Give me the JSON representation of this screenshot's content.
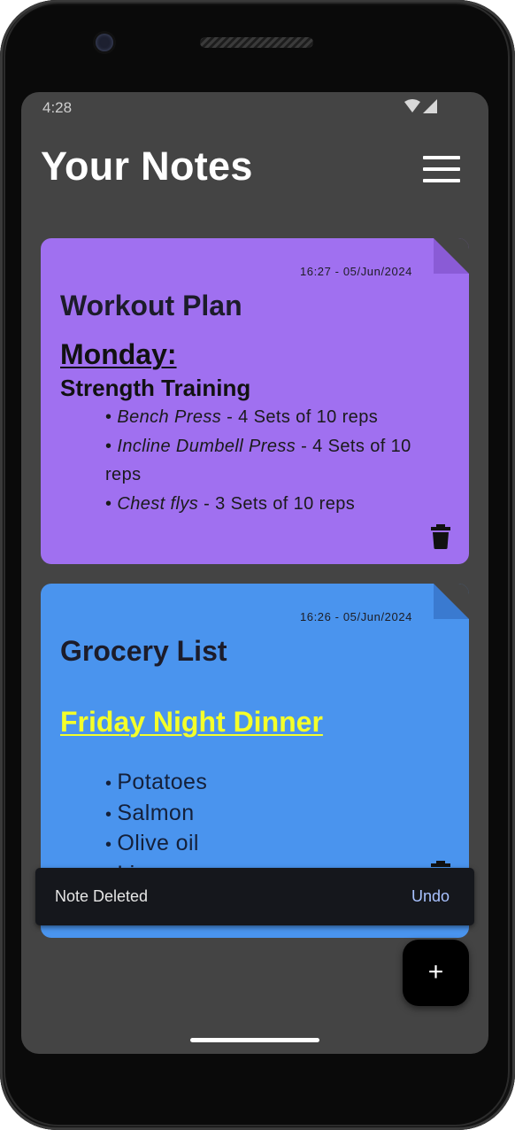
{
  "status_bar": {
    "time": "4:28",
    "icons": [
      "wifi-icon",
      "signal-icon"
    ]
  },
  "header": {
    "title": "Your Notes",
    "menu_icon": "hamburger-menu-icon"
  },
  "notes": [
    {
      "timestamp": "16:27 - 05/Jun/2024",
      "title": "Workout Plan",
      "color": "#a070f0",
      "fold_color": "#8a5bd6",
      "day_heading": "Monday:",
      "sub_heading": "Strength Training",
      "items": [
        {
          "exercise": "Bench Press",
          "detail": " - 4 Sets of 10 reps"
        },
        {
          "exercise": "Incline Dumbell Press",
          "detail": " - 4 Sets of 10 reps"
        },
        {
          "exercise": "Chest flys",
          "detail": " - 3 Sets of 10 reps"
        }
      ],
      "delete_icon": "trash-icon"
    },
    {
      "timestamp": "16:26 - 05/Jun/2024",
      "title": "Grocery List",
      "color": "#4a94ee",
      "fold_color": "#3a7ad0",
      "heading": "Friday Night Dinner",
      "heading_color": "#f4ff2a",
      "items": [
        "Potatoes",
        "Salmon",
        "Olive oil",
        "Limes"
      ],
      "delete_icon": "trash-icon"
    }
  ],
  "snackbar": {
    "message": "Note Deleted",
    "action": "Undo"
  },
  "fab": {
    "label": "+",
    "icon": "add-icon"
  },
  "colors": {
    "screen_background": "#444444",
    "snackbar_background": "#15171c",
    "undo_accent": "#a9c2ff"
  }
}
